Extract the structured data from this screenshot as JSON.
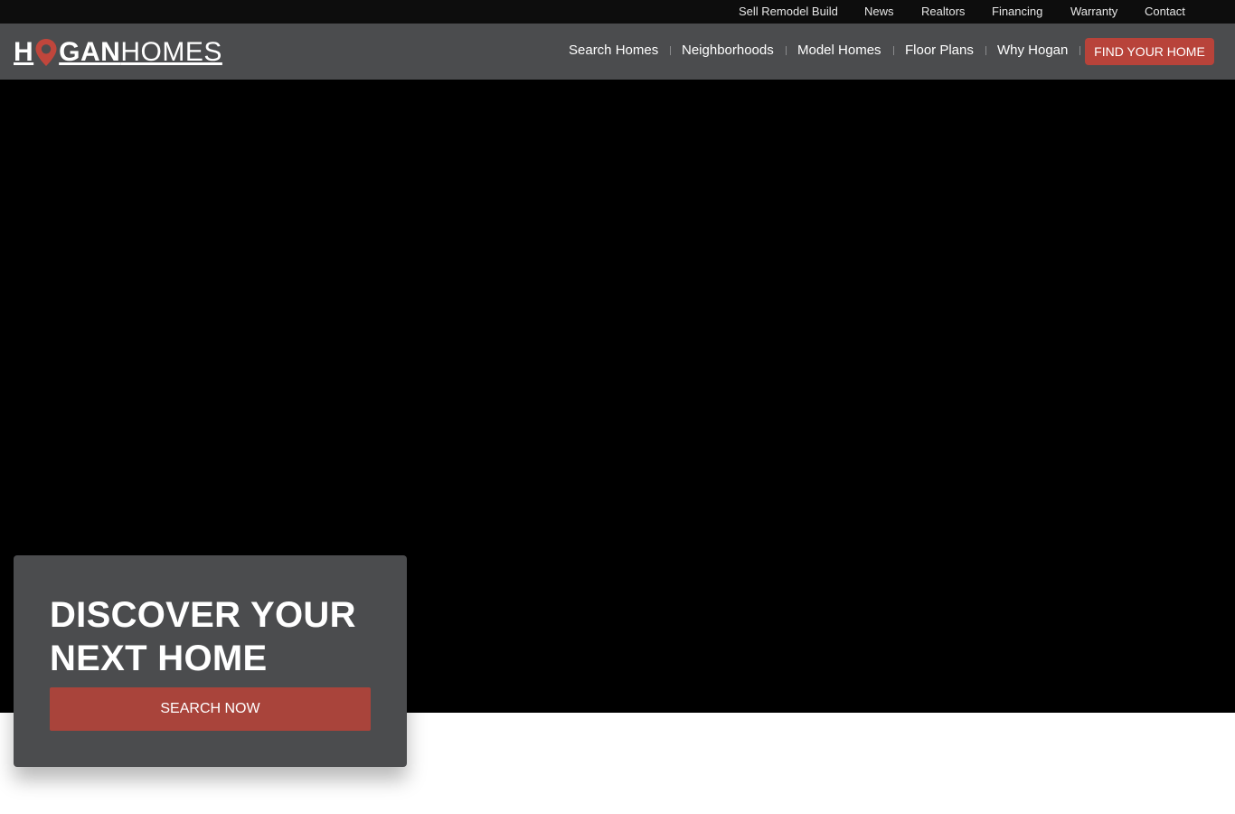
{
  "utility_nav": {
    "items": [
      "Sell Remodel Build",
      "News",
      "Realtors",
      "Financing",
      "Warranty",
      "Contact"
    ]
  },
  "brand": {
    "logo_part1_before": "H",
    "logo_part1_after": "GAN",
    "logo_part2": "HOMES",
    "accent_color": "#c0463c",
    "icon": "map-pin-icon"
  },
  "main_nav": {
    "items": [
      "Search Homes",
      "Neighborhoods",
      "Model Homes",
      "Floor Plans",
      "Why Hogan"
    ],
    "cta_label": "FIND YOUR HOME"
  },
  "hero": {
    "heading": "DISCOVER YOUR NEXT HOME",
    "button_label": "SEARCH NOW"
  }
}
